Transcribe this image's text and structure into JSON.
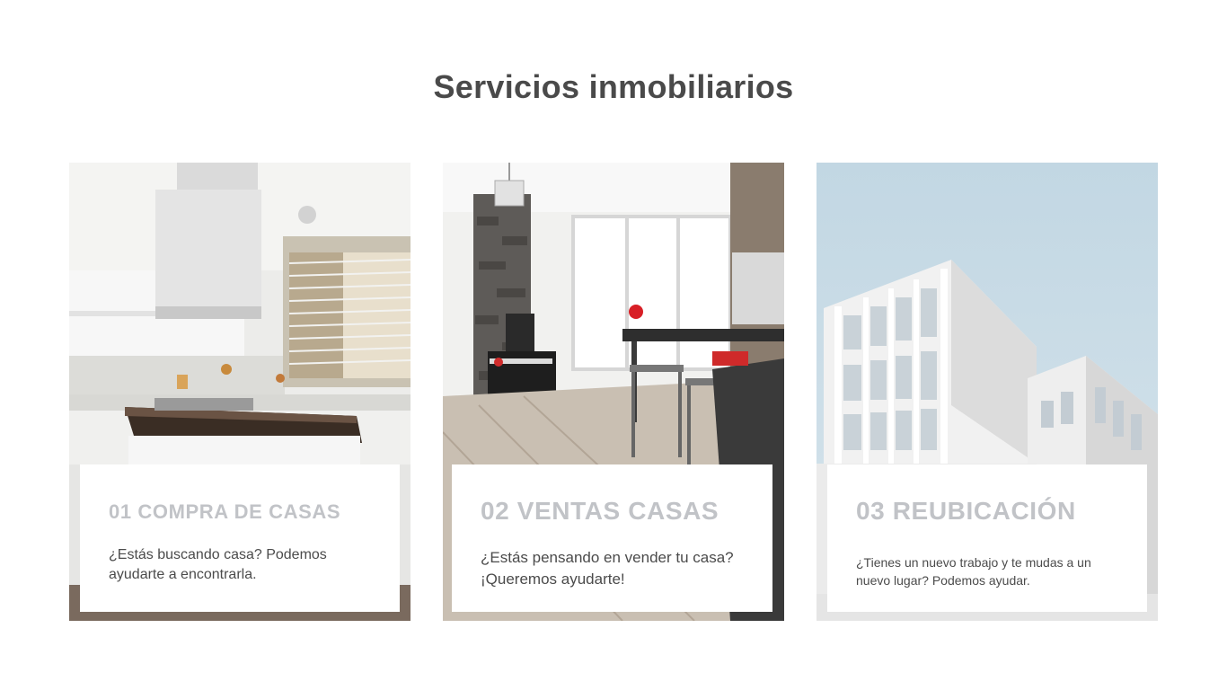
{
  "page": {
    "title": "Servicios inmobiliarios"
  },
  "cards": [
    {
      "title": "01 COMPRA DE CASAS",
      "description": "¿Estás buscando casa? Podemos ayudarte a encontrarla.",
      "image_alt": "kitchen-photo"
    },
    {
      "title": "02 VENTAS CASAS",
      "description": "¿Estás pensando en vender tu casa? ¡Queremos ayudarte!",
      "image_alt": "living-dining-room-photo"
    },
    {
      "title": "03 REUBICACIÓN",
      "description": "¿Tienes un nuevo trabajo y te mudas a un nuevo lugar? Podemos ayudar.",
      "image_alt": "modern-building-photo"
    }
  ],
  "colors": {
    "title_text": "#4a4a4a",
    "card_title_text": "#c1c3c7",
    "body_text": "#4b4b4b",
    "sky": "#c4d8e4"
  }
}
